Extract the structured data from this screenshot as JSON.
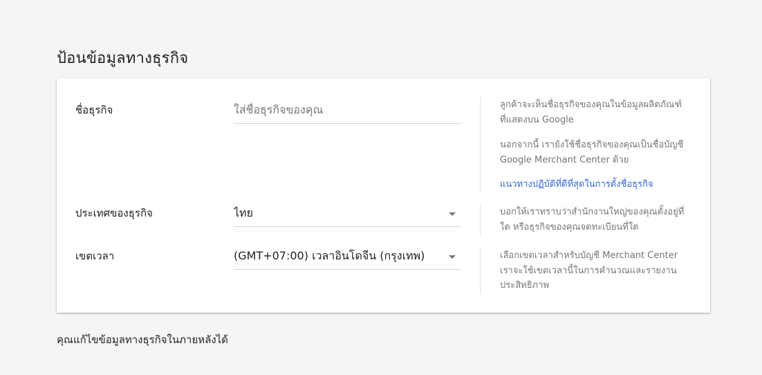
{
  "page": {
    "title": "ป้อนข้อมูลทางธุรกิจ",
    "footer_note": "คุณแก้ไขข้อมูลทางธุรกิจในภายหลังได้"
  },
  "business_name": {
    "label": "ชื่อธุรกิจ",
    "placeholder": "ใส่ชื่อธุรกิจของคุณ",
    "value": "",
    "help_1": "ลูกค้าจะเห็นชื่อธุรกิจของคุณในข้อมูลผลิตภัณฑ์ที่แสดงบน Google",
    "help_2": "นอกจากนี้ เรายังใช้ชื่อธุรกิจของคุณเป็นชื่อบัญชี Google Merchant Center ด้วย",
    "help_link": "แนวทางปฏิบัติที่ดีที่สุดในการตั้งชื่อธุรกิจ"
  },
  "country": {
    "label": "ประเทศของธุรกิจ",
    "selected": "ไทย",
    "help": "บอกให้เราทราบว่าสำนักงานใหญ่ของคุณตั้งอยู่ที่ใด หรือธุรกิจของคุณจดทะเบียนที่ใด"
  },
  "timezone": {
    "label": "เขตเวลา",
    "selected": "(GMT+07:00) เวลาอินโดจีน (กรุงเทพ)",
    "help": "เลือกเขตเวลาสำหรับบัญชี Merchant Center เราจะใช้เขตเวลานี้ในการคำนวณและรายงานประสิทธิภาพ"
  },
  "colors": {
    "background": "#f5f5f5",
    "card": "#ffffff",
    "link": "#3367d6",
    "help_text": "#757575",
    "divider": "#e0e0e0"
  },
  "icons": {
    "dropdown": "caret-down-icon"
  }
}
